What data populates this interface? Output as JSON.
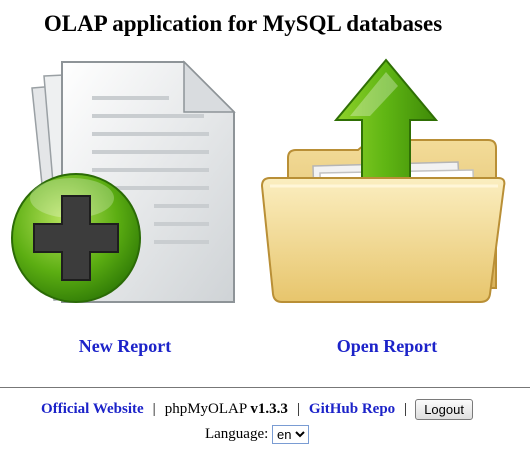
{
  "page": {
    "title": "OLAP application for MySQL databases"
  },
  "tiles": {
    "new_report": {
      "label": "New Report",
      "icon": "new-document-plus-icon"
    },
    "open_report": {
      "label": "Open Report",
      "icon": "open-folder-arrow-icon"
    }
  },
  "footer": {
    "official_website": "Official Website",
    "separator": "|",
    "product_name": "phpMyOLAP ",
    "version": "v1.3.3",
    "github": "GitHub Repo",
    "logout": "Logout",
    "language_label": "Language:",
    "language_value": "en"
  },
  "colors": {
    "link": "#1c23c9",
    "green": "#4fa80e",
    "folder": "#e9c978"
  }
}
